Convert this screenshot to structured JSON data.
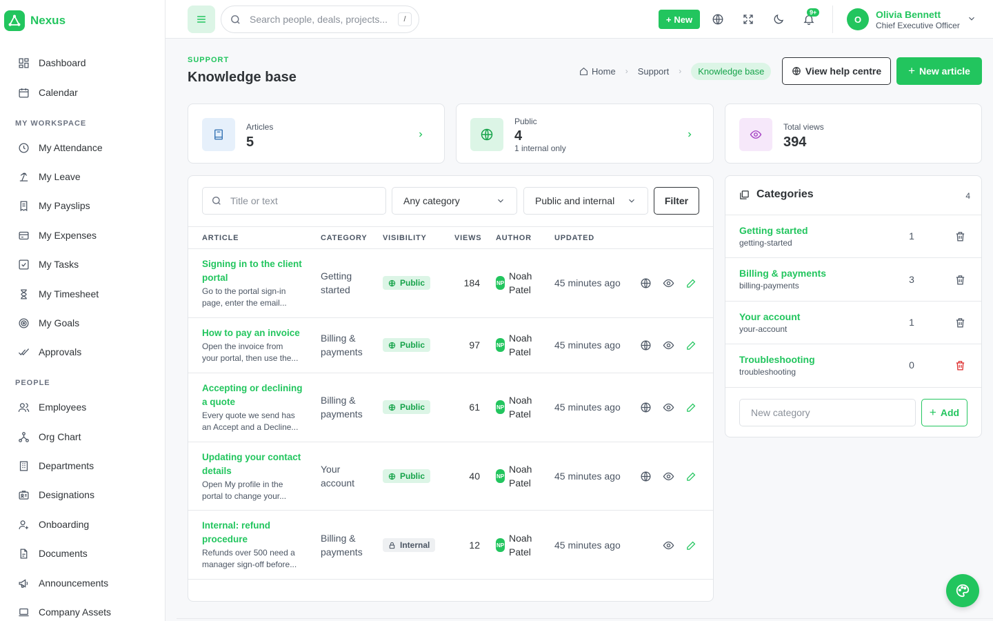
{
  "app": {
    "name": "Nexus",
    "accent": "#22c55e"
  },
  "sidebar": {
    "top": [
      {
        "label": "Dashboard",
        "icon": "dashboard-icon"
      },
      {
        "label": "Calendar",
        "icon": "calendar-icon"
      }
    ],
    "sections": [
      {
        "title": "MY WORKSPACE",
        "items": [
          {
            "label": "My Attendance",
            "icon": "clock-icon"
          },
          {
            "label": "My Leave",
            "icon": "beach-icon"
          },
          {
            "label": "My Payslips",
            "icon": "receipt-icon"
          },
          {
            "label": "My Expenses",
            "icon": "card-icon"
          },
          {
            "label": "My Tasks",
            "icon": "check-square-icon"
          },
          {
            "label": "My Timesheet",
            "icon": "hourglass-icon"
          },
          {
            "label": "My Goals",
            "icon": "target-icon"
          },
          {
            "label": "Approvals",
            "icon": "double-check-icon"
          }
        ]
      },
      {
        "title": "PEOPLE",
        "items": [
          {
            "label": "Employees",
            "icon": "users-icon"
          },
          {
            "label": "Org Chart",
            "icon": "org-chart-icon"
          },
          {
            "label": "Departments",
            "icon": "building-icon"
          },
          {
            "label": "Designations",
            "icon": "id-badge-icon"
          },
          {
            "label": "Onboarding",
            "icon": "user-plus-icon"
          },
          {
            "label": "Documents",
            "icon": "document-icon"
          },
          {
            "label": "Announcements",
            "icon": "megaphone-icon"
          },
          {
            "label": "Company Assets",
            "icon": "laptop-icon"
          }
        ]
      }
    ]
  },
  "topbar": {
    "search_placeholder": "Search people, deals, projects...",
    "search_shortcut": "/",
    "new_label": "New",
    "notif_badge": "9+",
    "user": {
      "initial": "O",
      "name": "Olivia Bennett",
      "role": "Chief Executive Officer"
    }
  },
  "page": {
    "eyebrow": "SUPPORT",
    "title": "Knowledge base",
    "breadcrumb": [
      "Home",
      "Support",
      "Knowledge base"
    ],
    "view_help_label": "View help centre",
    "new_article_label": "New article"
  },
  "stats": [
    {
      "label": "Articles",
      "value": "5",
      "sub": ""
    },
    {
      "label": "Public",
      "value": "4",
      "sub": "1 internal only"
    },
    {
      "label": "Total views",
      "value": "394",
      "sub": ""
    }
  ],
  "filters": {
    "search_placeholder": "Title or text",
    "category": "Any category",
    "visibility": "Public and internal",
    "button": "Filter"
  },
  "table": {
    "headers": [
      "ARTICLE",
      "CATEGORY",
      "VISIBILITY",
      "VIEWS",
      "AUTHOR",
      "UPDATED"
    ],
    "rows": [
      {
        "title": "Signing in to the client portal",
        "excerpt": "Go to the portal sign-in page, enter the email...",
        "category": "Getting started",
        "visibility": "Public",
        "views": "184",
        "author_initials": "NP",
        "author": "Noah Patel",
        "updated": "45 minutes ago"
      },
      {
        "title": "How to pay an invoice",
        "excerpt": "Open the invoice from your portal, then use the...",
        "category": "Billing & payments",
        "visibility": "Public",
        "views": "97",
        "author_initials": "NP",
        "author": "Noah Patel",
        "updated": "45 minutes ago"
      },
      {
        "title": "Accepting or declining a quote",
        "excerpt": "Every quote we send has an Accept and a Decline...",
        "category": "Billing & payments",
        "visibility": "Public",
        "views": "61",
        "author_initials": "NP",
        "author": "Noah Patel",
        "updated": "45 minutes ago"
      },
      {
        "title": "Updating your contact details",
        "excerpt": "Open My profile in the portal to change your...",
        "category": "Your account",
        "visibility": "Public",
        "views": "40",
        "author_initials": "NP",
        "author": "Noah Patel",
        "updated": "45 minutes ago"
      },
      {
        "title": "Internal: refund procedure",
        "excerpt": "Refunds over 500 need a manager sign-off before...",
        "category": "Billing & payments",
        "visibility": "Internal",
        "views": "12",
        "author_initials": "NP",
        "author": "Noah Patel",
        "updated": "45 minutes ago"
      }
    ]
  },
  "categories": {
    "title": "Categories",
    "count": "4",
    "items": [
      {
        "name": "Getting started",
        "slug": "getting-started",
        "count": "1"
      },
      {
        "name": "Billing & payments",
        "slug": "billing-payments",
        "count": "3"
      },
      {
        "name": "Your account",
        "slug": "your-account",
        "count": "1"
      },
      {
        "name": "Troubleshooting",
        "slug": "troubleshooting",
        "count": "0"
      }
    ],
    "new_placeholder": "New category",
    "add_label": "Add"
  }
}
